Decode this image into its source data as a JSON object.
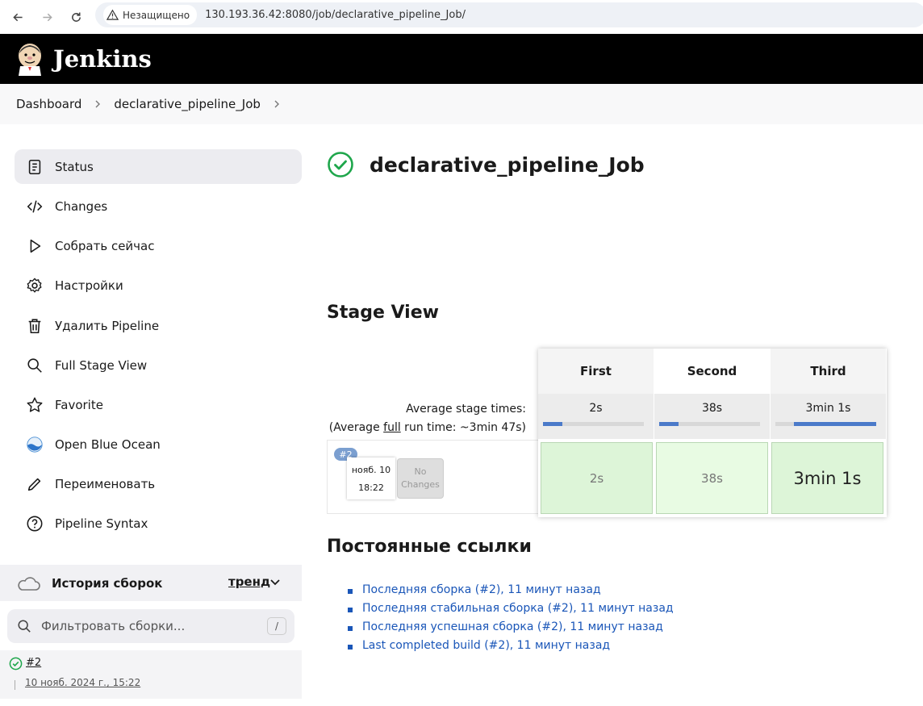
{
  "browser": {
    "security_label": "Незащищено",
    "url": "130.193.36.42:8080/job/declarative_pipeline_Job/"
  },
  "header": {
    "app_name": "Jenkins"
  },
  "breadcrumb": {
    "items": [
      "Dashboard",
      "declarative_pipeline_Job"
    ]
  },
  "sidebar": {
    "items": [
      {
        "label": "Status",
        "icon": "document-icon"
      },
      {
        "label": "Changes",
        "icon": "code-icon"
      },
      {
        "label": "Собрать сейчас",
        "icon": "play-icon"
      },
      {
        "label": "Настройки",
        "icon": "gear-icon"
      },
      {
        "label": "Удалить Pipeline",
        "icon": "trash-icon"
      },
      {
        "label": "Full Stage View",
        "icon": "search-icon"
      },
      {
        "label": "Favorite",
        "icon": "star-icon"
      },
      {
        "label": "Open Blue Ocean",
        "icon": "blue-ocean-icon"
      },
      {
        "label": "Переименовать",
        "icon": "pencil-icon"
      },
      {
        "label": "Pipeline Syntax",
        "icon": "help-icon"
      }
    ],
    "history": {
      "title": "История сборок",
      "trend": "тренд",
      "filter_placeholder": "Фильтровать сборки...",
      "filter_shortcut": "/",
      "builds": [
        {
          "number": "#2",
          "date": "10 нояб. 2024 г., 15:22",
          "status": "success"
        }
      ]
    }
  },
  "main": {
    "title": "declarative_pipeline_Job",
    "stage_view_heading": "Stage View",
    "avg_stage_times_label": "Average stage times:",
    "avg_run_prefix": "(Average ",
    "avg_run_link": "full",
    "avg_run_suffix": " run time: ~3min 47s)",
    "stages": [
      {
        "name": "First",
        "avg": "2s",
        "bar_fraction": 0.19
      },
      {
        "name": "Second",
        "avg": "38s",
        "bar_fraction": 0.19
      },
      {
        "name": "Third",
        "avg": "3min 1s",
        "bar_fraction": 0.82
      }
    ],
    "run": {
      "badge": "#2",
      "date": "нояб. 10",
      "time": "18:22",
      "changes_line1": "No",
      "changes_line2": "Changes",
      "durations": [
        "2s",
        "38s",
        "3min 1s"
      ]
    },
    "permalinks_heading": "Постоянные ссылки",
    "permalinks": [
      "Последняя сборка (#2), 11 минут назад",
      "Последняя стабильная сборка (#2), 11 минут назад",
      "Последняя успешная сборка (#2), 11 минут назад",
      "Last completed build (#2), 11 минут назад"
    ]
  },
  "colors": {
    "header_bg": "#000000",
    "success": "#1ea64b",
    "link": "#1a56b8",
    "stage_success": "#ddf5d8"
  }
}
